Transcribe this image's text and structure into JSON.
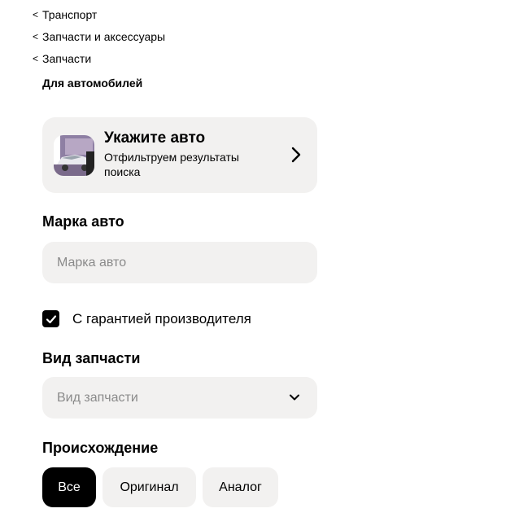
{
  "breadcrumbs": [
    {
      "label": "Транспорт"
    },
    {
      "label": "Запчасти и аксессуары"
    },
    {
      "label": "Запчасти"
    }
  ],
  "current_category": "Для автомобилей",
  "car_card": {
    "title": "Укажите авто",
    "subtitle": "Отфильтруем результаты поиска"
  },
  "brand": {
    "label": "Марка авто",
    "placeholder": "Марка авто"
  },
  "warranty": {
    "label": "С гарантией производителя",
    "checked": true
  },
  "part_type": {
    "label": "Вид запчасти",
    "placeholder": "Вид запчасти"
  },
  "origin": {
    "label": "Происхождение",
    "options": [
      {
        "label": "Все",
        "selected": true
      },
      {
        "label": "Оригинал",
        "selected": false
      },
      {
        "label": "Аналог",
        "selected": false
      }
    ]
  },
  "colors": {
    "field_bg": "#f2f1f0",
    "selected_bg": "#000000",
    "placeholder_text": "#8a8a8a"
  }
}
